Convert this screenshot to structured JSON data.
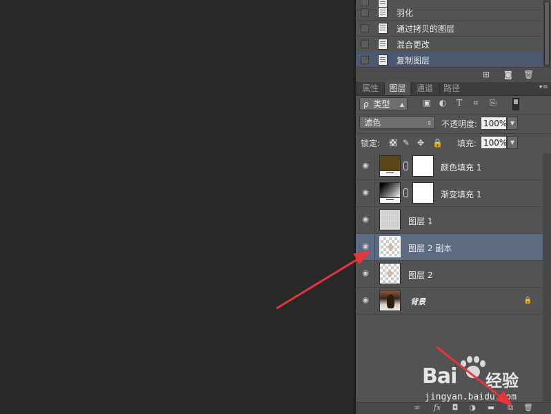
{
  "history": {
    "items": [
      {
        "label": ""
      },
      {
        "label": "羽化"
      },
      {
        "label": "通过拷贝的图层"
      },
      {
        "label": "混合更改"
      },
      {
        "label": "复制图层"
      }
    ],
    "footer_icons": [
      "new-snapshot-icon",
      "camera-icon",
      "trash-icon"
    ]
  },
  "tabs": [
    {
      "label": "属性"
    },
    {
      "label": "图层"
    },
    {
      "label": "通道"
    },
    {
      "label": "路径"
    }
  ],
  "filter": {
    "kind_label": "类型",
    "search_glyph": "ρ"
  },
  "blend": {
    "mode": "滤色",
    "opacity_label": "不透明度:",
    "opacity_value": "100%"
  },
  "lock": {
    "label": "锁定:",
    "fill_label": "填充:",
    "fill_value": "100%"
  },
  "layers": [
    {
      "name": "颜色填充 1"
    },
    {
      "name": "渐变填充 1"
    },
    {
      "name": "图层 1"
    },
    {
      "name": "图层 2 副本"
    },
    {
      "name": "图层 2"
    },
    {
      "name": "背景"
    }
  ],
  "watermark": {
    "brand": "Bai",
    "brand_suffix": "经验",
    "url": "jingyan.baidu.com"
  },
  "colors": {
    "selected_row": "#5d6b82",
    "annotation_arrow": "#e8353a"
  }
}
